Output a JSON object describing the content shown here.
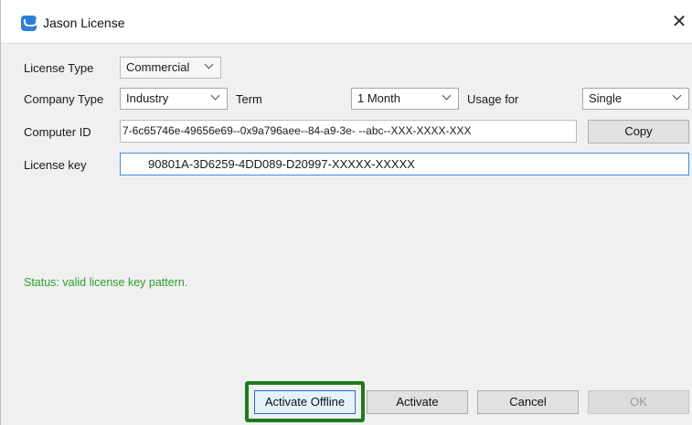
{
  "window": {
    "title": "Jason License",
    "close_glyph": "✕"
  },
  "form": {
    "license_type": {
      "label": "License Type",
      "value": "Commercial"
    },
    "company_type": {
      "label": "Company Type",
      "value": "Industry"
    },
    "term": {
      "label": "Term",
      "value": "1 Month"
    },
    "usage_for": {
      "label": "Usage for",
      "value": "Single"
    },
    "computer_id": {
      "label": "Computer ID",
      "value": "7-6c65746e-49656e69--0x9a796aee--84-a9-3e-      --abc--XXX-XXXX-XXX"
    },
    "license_key": {
      "label": "License key",
      "value": "90801A-3D6259-4DD089-D20997-XXXXX-XXXXX"
    }
  },
  "buttons": {
    "copy": "Copy",
    "activate_offline": "Activate Offline",
    "activate": "Activate",
    "cancel": "Cancel",
    "ok": "OK"
  },
  "status": {
    "text": "Status: valid license key pattern.",
    "color": "#2ca02c"
  },
  "colors": {
    "highlight": "#1e7a1e",
    "accent": "#3b8fde"
  },
  "icons": {
    "app": "app-logo-icon",
    "close": "close-icon",
    "dropdown": "chevron-down-icon"
  }
}
